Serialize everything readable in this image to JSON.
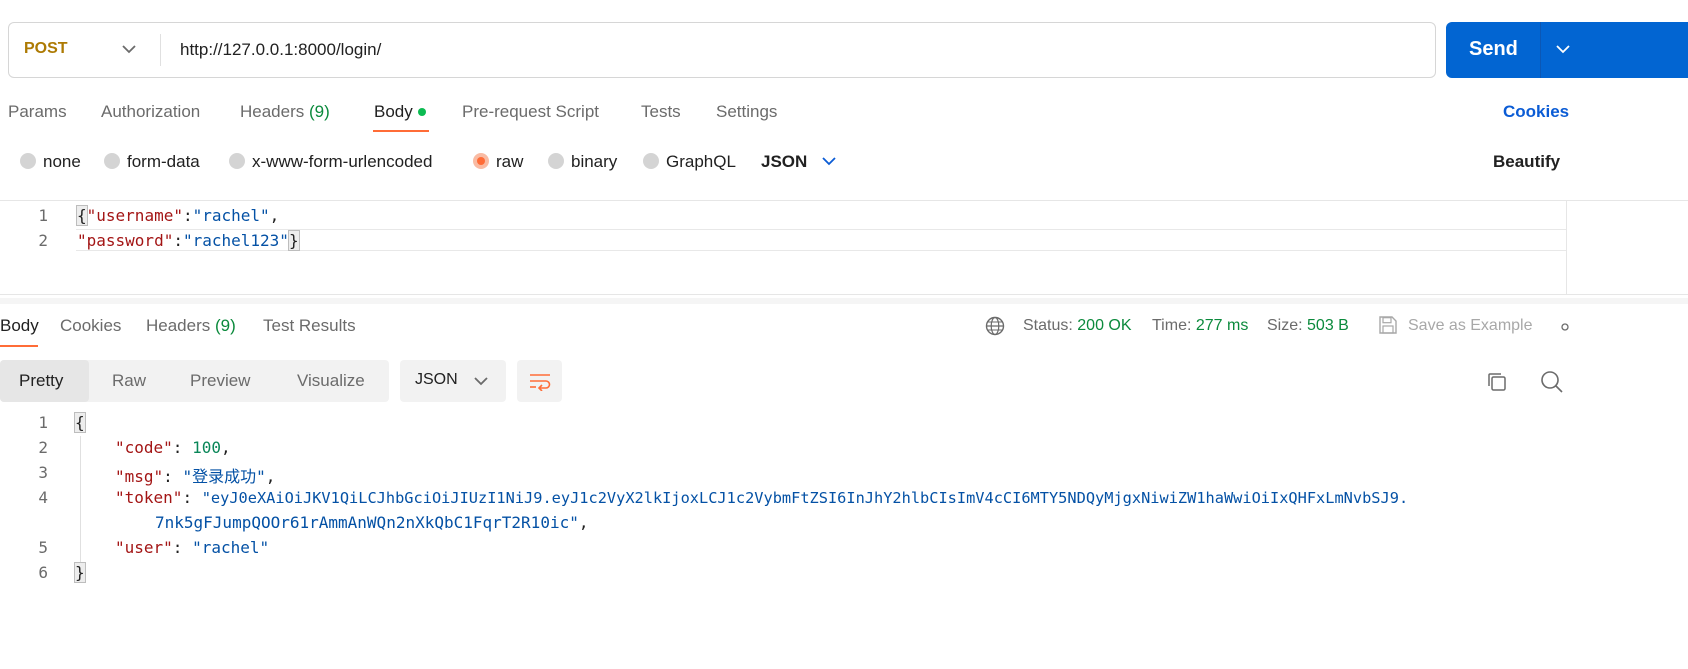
{
  "request": {
    "method": "POST",
    "url": "http://127.0.0.1:8000/login/",
    "send_label": "Send"
  },
  "request_tabs": {
    "params": "Params",
    "authorization": "Authorization",
    "headers": "Headers",
    "headers_count": "(9)",
    "body": "Body",
    "prerequest": "Pre-request Script",
    "tests": "Tests",
    "settings": "Settings",
    "cookies": "Cookies"
  },
  "body_types": {
    "none": "none",
    "form_data": "form-data",
    "urlencoded": "x-www-form-urlencoded",
    "raw": "raw",
    "binary": "binary",
    "graphql": "GraphQL",
    "selected_format": "JSON",
    "beautify": "Beautify"
  },
  "request_body": {
    "line_numbers": [
      "1",
      "2"
    ],
    "line1": {
      "open": "{",
      "key": "\"username\"",
      "colon": ":",
      "value": "\"rachel\"",
      "comma": ","
    },
    "line2": {
      "key": "\"password\"",
      "colon": ":",
      "value": "\"rachel123\"",
      "close": "}"
    }
  },
  "response_tabs": {
    "body": "Body",
    "cookies": "Cookies",
    "headers": "Headers",
    "headers_count": "(9)",
    "test_results": "Test Results"
  },
  "response_meta": {
    "status_label": "Status:",
    "status_value": "200 OK",
    "time_label": "Time:",
    "time_value": "277 ms",
    "size_label": "Size:",
    "size_value": "503 B",
    "save_example": "Save as Example"
  },
  "view_modes": {
    "pretty": "Pretty",
    "raw": "Raw",
    "preview": "Preview",
    "visualize": "Visualize",
    "format": "JSON"
  },
  "response_body": {
    "line_numbers": [
      "1",
      "2",
      "3",
      "4",
      "",
      "5",
      "6"
    ],
    "open": "{",
    "close": "}",
    "code_key": "\"code\"",
    "code_value": "100",
    "msg_key": "\"msg\"",
    "msg_value": "\"登录成功\"",
    "token_key": "\"token\"",
    "token_value_1": "\"eyJ0eXAiOiJKV1QiLCJhbGciOiJIUzI1NiJ9.eyJ1c2VyX2lkIjoxLCJ1c2VybmFtZSI6InJhY2hlbCIsImV4cCI6MTY5NDQyMjgxNiwiZW1haWwiOiIxQHFxLmNvbSJ9.",
    "token_value_2": "7nk5gFJumpQOOr61rAmmAnWQn2nXkQbC1FqrT2R10ic\"",
    "user_key": "\"user\"",
    "user_value": "\"rachel\""
  },
  "colors": {
    "accent": "#ff6c37",
    "primary": "#0265d2",
    "status_green": "#0b8a3c",
    "method_post": "#ad7a03"
  }
}
